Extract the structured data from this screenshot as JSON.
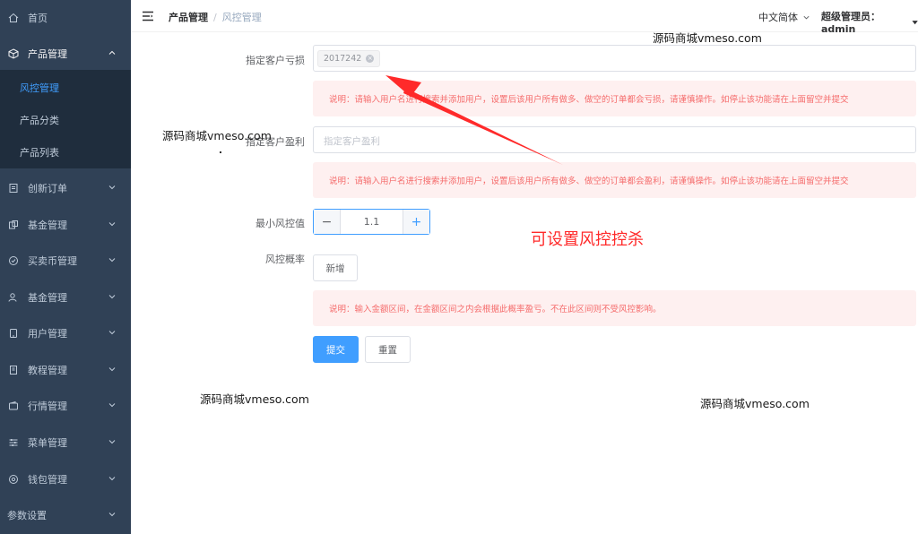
{
  "sidebar": {
    "items": [
      {
        "label": "首页",
        "icon": "home-icon"
      },
      {
        "label": "产品管理",
        "icon": "box-icon",
        "open": true
      },
      {
        "label": "创新订单",
        "icon": "document-icon"
      },
      {
        "label": "基金管理",
        "icon": "fund-icon"
      },
      {
        "label": "买卖币管理",
        "icon": "check-circle-icon"
      },
      {
        "label": "基金管理",
        "icon": "user-group-icon"
      },
      {
        "label": "用户管理",
        "icon": "tablet-icon"
      },
      {
        "label": "教程管理",
        "icon": "book-icon"
      },
      {
        "label": "行情管理",
        "icon": "wallet-icon"
      },
      {
        "label": "菜单管理",
        "icon": "sliders-icon"
      },
      {
        "label": "钱包管理",
        "icon": "gear-icon"
      },
      {
        "label": "参数设置",
        "icon": ""
      }
    ],
    "submenu": [
      {
        "label": "风控管理",
        "active": true
      },
      {
        "label": "产品分类"
      },
      {
        "label": "产品列表"
      }
    ]
  },
  "header": {
    "breadcrumb": [
      "产品管理",
      "风控管理"
    ],
    "language": "中文简体",
    "user": "超级管理员：admin"
  },
  "form": {
    "loss_label": "指定客户亏损",
    "loss_tag": "2017242",
    "notice_loss": "说明：请输入用户名进行搜索并添加用户，设置后该用户所有做多、做空的订单都会亏损，请谨慎操作。如停止该功能请在上面留空并提交",
    "profit_label": "指定客户盈利",
    "profit_placeholder": "指定客户盈利",
    "notice_profit": "说明：请输入用户名进行搜索并添加用户，设置后该用户所有做多、做空的订单都会盈利，请谨慎操作。如停止该功能请在上面留空并提交",
    "min_label": "最小风控值",
    "min_value": "1.1",
    "rate_label": "风控概率",
    "add_button": "新增",
    "notice_rate": "说明：输入金额区间，在金额区间之内会根据此概率盈亏。不在此区间则不受风控影响。",
    "submit_button": "提交",
    "reset_button": "重置"
  },
  "overlay": {
    "watermark": "源码商城vmeso.com",
    "annotation": "可设置风控控杀"
  },
  "colors": {
    "sidebar_bg": "#304156",
    "primary": "#409eff",
    "notice_bg": "#fef0f0",
    "notice_text": "#f56c6c",
    "annotation": "#ff2a2a"
  }
}
